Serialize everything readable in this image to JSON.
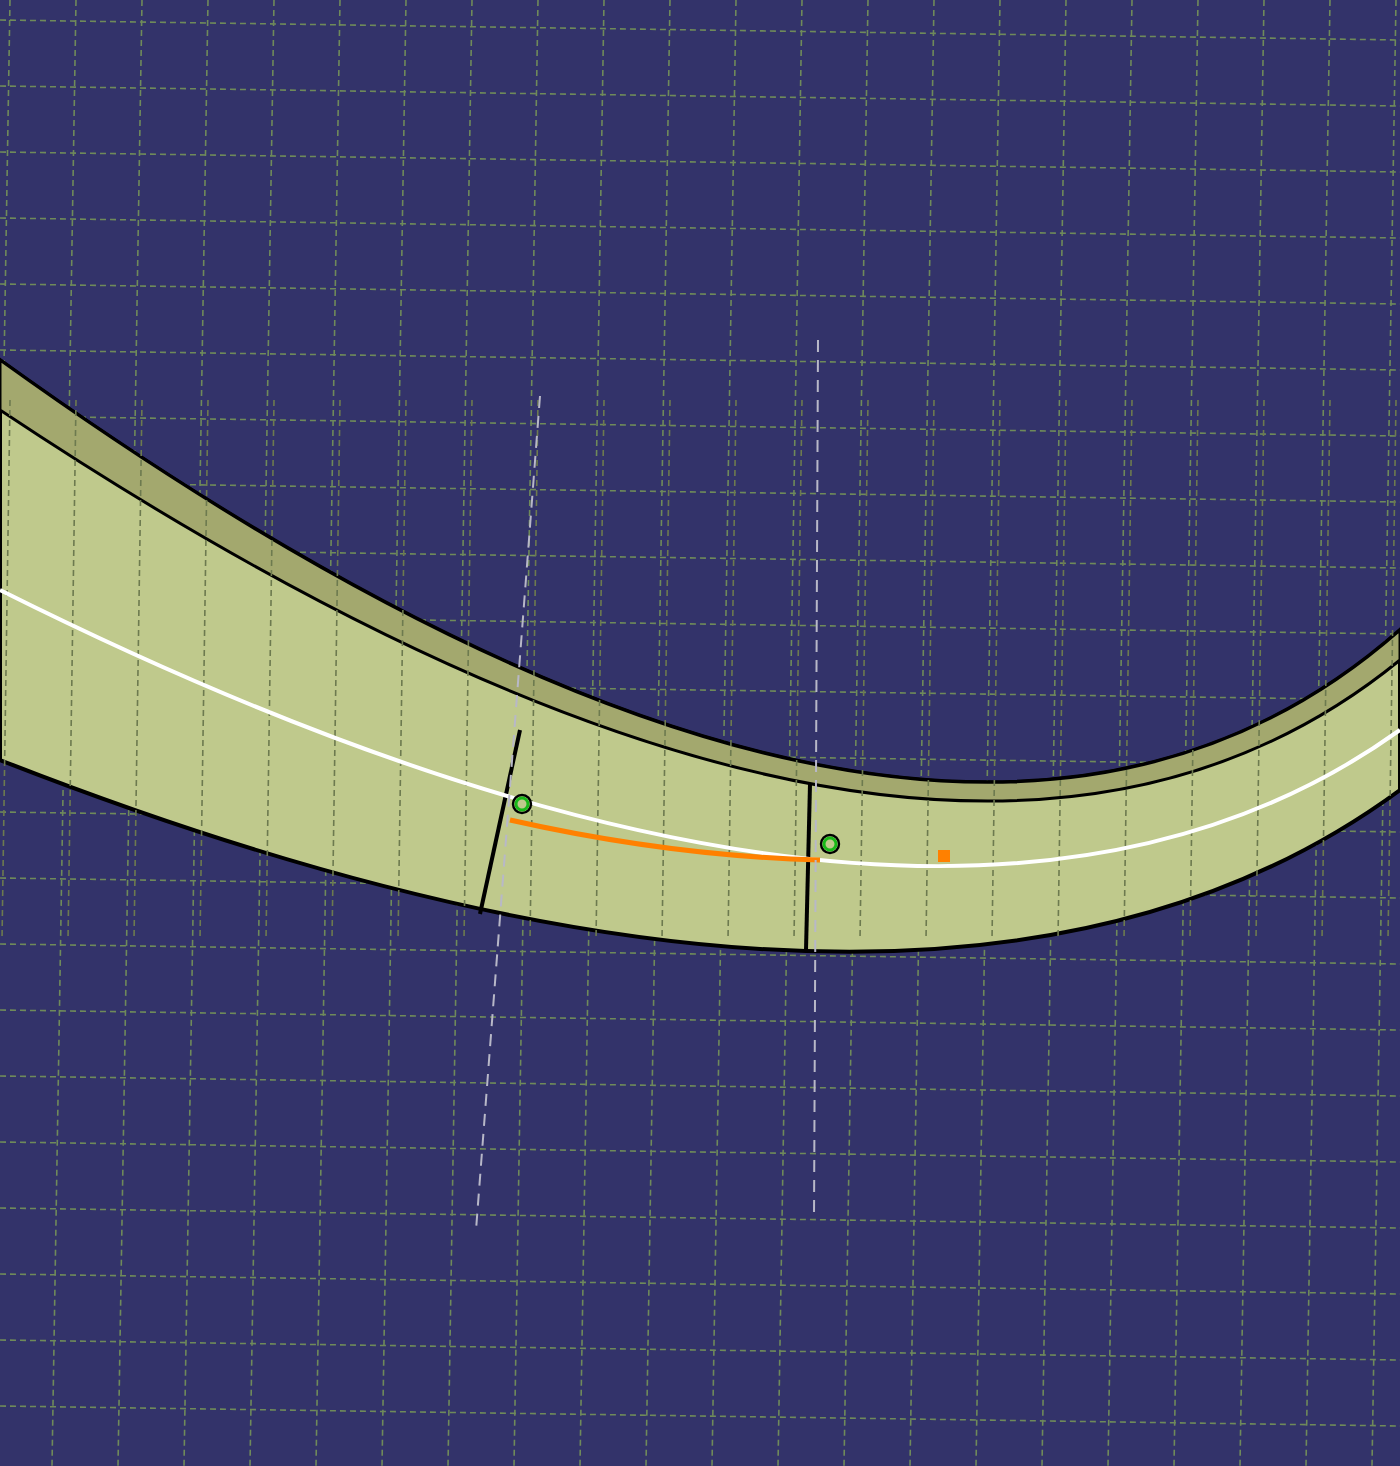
{
  "viewport": {
    "show_grid": true
  }
}
